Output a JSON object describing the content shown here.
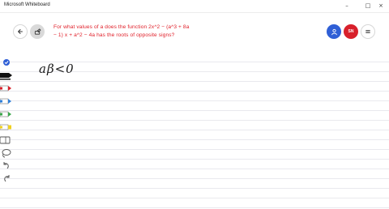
{
  "window": {
    "title": "Microsoft Whiteboard",
    "minimize_glyph": "–",
    "maximize_glyph": "□",
    "close_glyph": "×"
  },
  "header": {
    "avatar_initials": "SN"
  },
  "question": {
    "text": "For what values of a does the function 2x^2 − (a^3 + 8a − 1) x + a^2 − 4a has the roots of opposite signs?"
  },
  "board": {
    "handwriting": "aβ<0"
  },
  "toolbar": {
    "tools": [
      {
        "name": "select-tool",
        "color": "#2f5fd6"
      },
      {
        "name": "black-pen",
        "color": "#111111"
      },
      {
        "name": "red-pen",
        "color": "#d8202b"
      },
      {
        "name": "blue-pen",
        "color": "#2f7fd8"
      },
      {
        "name": "green-pen",
        "color": "#3aa64a"
      },
      {
        "name": "highlighter",
        "color": "#f0d020"
      },
      {
        "name": "eraser",
        "color": "#555555"
      },
      {
        "name": "lasso-tool",
        "color": "#555555"
      },
      {
        "name": "undo",
        "color": "#555555"
      },
      {
        "name": "redo",
        "color": "#555555"
      }
    ]
  }
}
